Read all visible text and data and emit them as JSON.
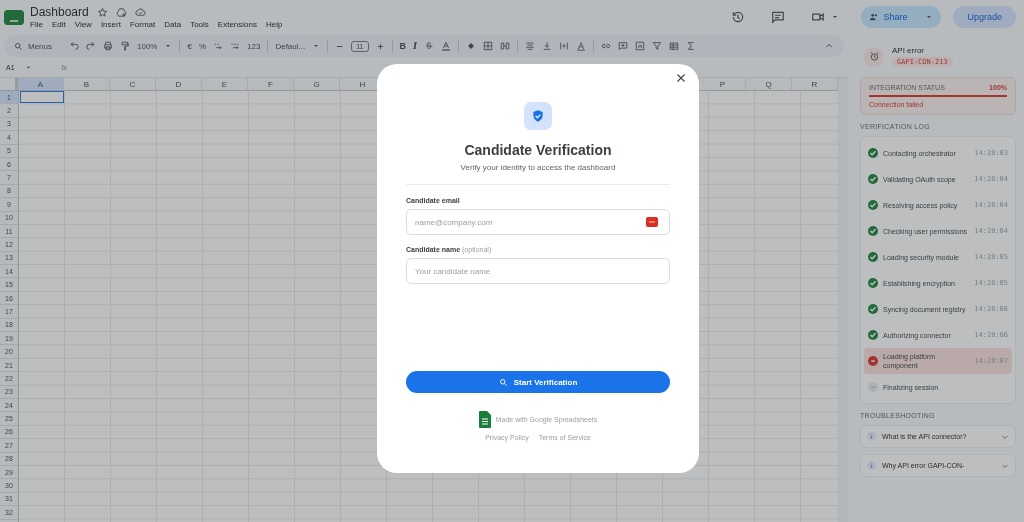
{
  "document": {
    "title": "Dashboard"
  },
  "menu": [
    "File",
    "Edit",
    "View",
    "Insert",
    "Format",
    "Data",
    "Tools",
    "Extensions",
    "Help"
  ],
  "header_buttons": {
    "share": "Share",
    "upgrade": "Upgrade"
  },
  "toolbar": {
    "search": "Menus",
    "zoom": "100%",
    "currency": "€",
    "percent": "%",
    "number_format": "123",
    "font": "Defaul...",
    "font_size": "11",
    "bold": "B",
    "italic": "I"
  },
  "formula_bar": {
    "cell_ref": "A1",
    "fx": "fx"
  },
  "sheet": {
    "columns_left": [
      {
        "label": "A",
        "selected": true
      },
      {
        "label": "B",
        "selected": false
      },
      {
        "label": "C",
        "selected": false
      },
      {
        "label": "D",
        "selected": false
      },
      {
        "label": "E",
        "selected": false
      },
      {
        "label": "F",
        "selected": false
      },
      {
        "label": "G",
        "selected": false
      },
      {
        "label": "H",
        "selected": false
      }
    ],
    "columns_right": [
      {
        "label": "P",
        "selected": false
      },
      {
        "label": "Q",
        "selected": false
      },
      {
        "label": "R",
        "selected": false
      }
    ],
    "rows": [
      {
        "label": "1",
        "selected": true
      },
      {
        "label": "2",
        "selected": false
      },
      {
        "label": "3",
        "selected": false
      },
      {
        "label": "4",
        "selected": false
      },
      {
        "label": "5",
        "selected": false
      },
      {
        "label": "6",
        "selected": false
      },
      {
        "label": "7",
        "selected": false
      },
      {
        "label": "8",
        "selected": false
      },
      {
        "label": "9",
        "selected": false
      },
      {
        "label": "10",
        "selected": false
      },
      {
        "label": "11",
        "selected": false
      },
      {
        "label": "12",
        "selected": false
      },
      {
        "label": "13",
        "selected": false
      },
      {
        "label": "14",
        "selected": false
      },
      {
        "label": "15",
        "selected": false
      },
      {
        "label": "16",
        "selected": false
      },
      {
        "label": "17",
        "selected": false
      },
      {
        "label": "18",
        "selected": false
      },
      {
        "label": "19",
        "selected": false
      },
      {
        "label": "20",
        "selected": false
      },
      {
        "label": "21",
        "selected": false
      },
      {
        "label": "22",
        "selected": false
      },
      {
        "label": "23",
        "selected": false
      },
      {
        "label": "24",
        "selected": false
      },
      {
        "label": "25",
        "selected": false
      },
      {
        "label": "26",
        "selected": false
      },
      {
        "label": "27",
        "selected": false
      },
      {
        "label": "28",
        "selected": false
      },
      {
        "label": "29",
        "selected": false
      },
      {
        "label": "30",
        "selected": false
      },
      {
        "label": "31",
        "selected": false
      },
      {
        "label": "32",
        "selected": false
      }
    ]
  },
  "side_panel": {
    "error": {
      "title": "API error",
      "code": "GAPI-CON-213"
    },
    "integration_status": {
      "label": "INTEGRATION STATUS",
      "value": "100%",
      "level": 1,
      "message": "Connection failed"
    },
    "verification_log": {
      "heading": "VERIFICATION LOG",
      "steps": [
        {
          "label": "Contacting orchestrator",
          "time": "14:28:03",
          "kind": "done"
        },
        {
          "label": "Validating OAuth scope",
          "time": "14:28:04",
          "kind": "done"
        },
        {
          "label": "Resolving access policy",
          "time": "14:28:04",
          "kind": "done"
        },
        {
          "label": "Checking user permissions",
          "time": "14:28:04",
          "kind": "done"
        },
        {
          "label": "Loading security module",
          "time": "14:28:05",
          "kind": "done"
        },
        {
          "label": "Establishing encryption",
          "time": "14:28:05",
          "kind": "done"
        },
        {
          "label": "Syncing document registry",
          "time": "14:28:06",
          "kind": "done"
        },
        {
          "label": "Authorizing connector",
          "time": "14:28:06",
          "kind": "done"
        },
        {
          "label": "Loading platform component",
          "time": "14:28:07",
          "kind": "error"
        },
        {
          "label": "Finalizing session",
          "kind": "pending"
        }
      ]
    },
    "troubleshooting": {
      "heading": "TROUBLESHOOTING",
      "items": [
        {
          "question": "What is the API connector?"
        },
        {
          "question": "Why API error GAPI-CON-"
        }
      ]
    }
  },
  "dialog": {
    "title": "Candidate Verification",
    "subtitle": "Verify your identity to access the dashboard",
    "fields": [
      {
        "label": "Candidate email",
        "placeholder": "name@company.com",
        "kind": "email"
      },
      {
        "label": "Candidate name",
        "note": "(optional)",
        "placeholder": "Your candidate name",
        "kind": "text"
      }
    ],
    "submit": "Start Verification",
    "footer": "Made with Google Spreadsheets",
    "links": [
      "Privacy Policy",
      "Terms of Service"
    ]
  }
}
